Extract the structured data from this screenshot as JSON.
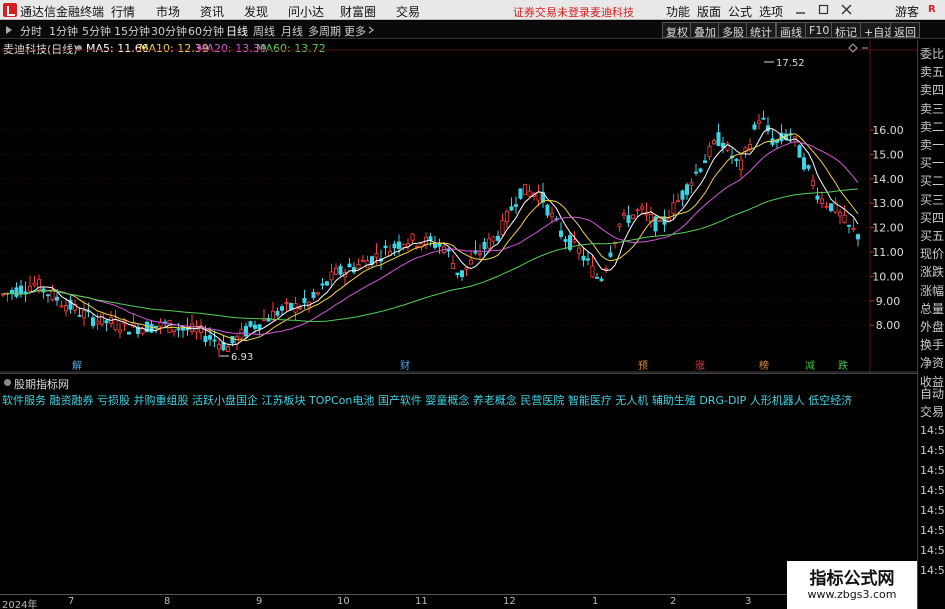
{
  "app": {
    "title": "通达信金融终端",
    "menu": [
      "行情",
      "市场",
      "资讯",
      "发现",
      "问小达",
      "财富圈",
      "交易"
    ],
    "status_text": "证券交易未登录",
    "stock_name_top": "麦迪科技",
    "right_menu": [
      "功能",
      "版面",
      "公式",
      "选项"
    ],
    "user": "游客",
    "r_tag": "R"
  },
  "toolbar": {
    "periods": [
      "分时",
      "1分钟",
      "5分钟",
      "15分钟",
      "30分钟",
      "60分钟",
      "日线",
      "周线",
      "月线",
      "多周期",
      "更多"
    ],
    "active_period": "日线",
    "right_buttons": [
      "复权",
      "叠加",
      "多股",
      "统计",
      "画线",
      "F10",
      "标记",
      "+自选",
      "返回"
    ]
  },
  "chart": {
    "stock_title": "麦迪科技(日线)",
    "ma_labels": [
      {
        "text": "MA5: 11.66",
        "color": "#ffffff"
      },
      {
        "text": "MA10: 12.39",
        "color": "#f0d34a"
      },
      {
        "text": "MA20: 13.39",
        "color": "#d05ad8"
      },
      {
        "text": "MA60: 13.72",
        "color": "#56d05a"
      }
    ],
    "price_ticks": [
      "16.00",
      "15.00",
      "14.00",
      "13.00",
      "12.00",
      "11.00",
      "10.00",
      "9.00",
      "8.00"
    ],
    "high_label": "17.52",
    "low_label": "6.93",
    "event_markers": [
      {
        "text": "解",
        "color": "#4fa8e8"
      },
      {
        "text": "财",
        "color": "#4fa8e8"
      },
      {
        "text": "预",
        "color": "#e08a30"
      },
      {
        "text": "涨",
        "color": "#e04040"
      },
      {
        "text": "榜",
        "color": "#e08a30"
      },
      {
        "text": "减",
        "color": "#40c040"
      },
      {
        "text": "跌",
        "color": "#40c040"
      }
    ],
    "colors": {
      "up": "#ff3c3c",
      "down": "#3ad4e4",
      "ma5": "#ffffff",
      "ma10": "#f0d34a",
      "ma20": "#d05ad8",
      "ma60": "#56d05a"
    }
  },
  "quote_panel": {
    "labels": [
      "委比",
      "卖五",
      "卖四",
      "卖三",
      "卖二",
      "卖一",
      "买一",
      "买二",
      "买三",
      "买四",
      "买五",
      "现价",
      "涨跌",
      "涨幅",
      "总量",
      "外盘",
      "换手",
      "净资",
      "收益"
    ],
    "section2": [
      "自动",
      "交易"
    ],
    "times": [
      "14:5",
      "14:5",
      "14:5",
      "14:5",
      "14:5",
      "14:5",
      "14:5",
      "14:5"
    ]
  },
  "indicator_panel": {
    "title": "股期指标网",
    "concepts": "软件服务 融资融券 亏损股 并购重组股 活跃小盘国企 江苏板块 TOPCon电池 国产软件 婴童概念 养老概念 民营医院 智能医疗 无人机 辅助生殖 DRG-DIP 人形机器人 低空经济"
  },
  "date_axis": [
    "2024年",
    "7",
    "8",
    "9",
    "10",
    "11",
    "12",
    "1",
    "2",
    "3"
  ],
  "watermark": {
    "line1": "指标公式网",
    "line2": "www.zbgs3.com"
  }
}
